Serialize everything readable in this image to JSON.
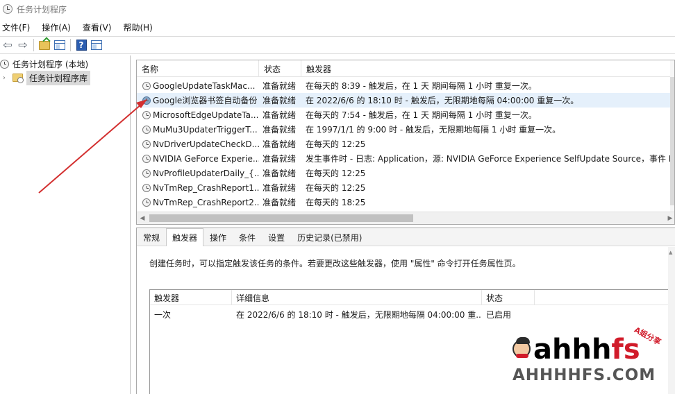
{
  "window": {
    "title": "任务计划程序"
  },
  "menu": [
    "文件(F)",
    "操作(A)",
    "查看(V)",
    "帮助(H)"
  ],
  "tree": {
    "root": "任务计划程序 (本地)",
    "child": "任务计划程序库",
    "expander": "›"
  },
  "task_list": {
    "columns": [
      "名称",
      "状态",
      "触发器"
    ],
    "rows": [
      {
        "name": "GoogleUpdateTaskMac...",
        "status": "准备就绪",
        "trigger": "在每天的 8:39 - 触发后，在 1 天 期间每隔 1 小时 重复一次。"
      },
      {
        "name": "Google浏览器书签自动备份",
        "status": "准备就绪",
        "trigger": "在 2022/6/6 的 18:10 时 - 触发后，无限期地每隔 04:00:00 重复一次。"
      },
      {
        "name": "MicrosoftEdgeUpdateTa...",
        "status": "准备就绪",
        "trigger": "在每天的 7:54 - 触发后，在 1 天 期间每隔 1 小时 重复一次。"
      },
      {
        "name": "MuMu3UpdaterTriggerT...",
        "status": "准备就绪",
        "trigger": "在 1997/1/1 的 9:00 时 - 触发后，无限期地每隔 1 小时 重复一次。"
      },
      {
        "name": "NvDriverUpdateCheckD...",
        "status": "准备就绪",
        "trigger": "在每天的 12:25"
      },
      {
        "name": "NVIDIA GeForce Experie...",
        "status": "准备就绪",
        "trigger": "发生事件时 - 日志: Application，源: NVIDIA GeForce Experience SelfUpdate Source，事件 ID"
      },
      {
        "name": "NvProfileUpdaterDaily_{...",
        "status": "准备就绪",
        "trigger": "在每天的 12:25"
      },
      {
        "name": "NvTmRep_CrashReport1...",
        "status": "准备就绪",
        "trigger": "在每天的 12:25"
      },
      {
        "name": "NvTmRep_CrashReport2...",
        "status": "准备就绪",
        "trigger": "在每天的 18:25"
      }
    ],
    "selected_index": 1
  },
  "detail": {
    "tabs": [
      "常规",
      "触发器",
      "操作",
      "条件",
      "设置",
      "历史记录(已禁用)"
    ],
    "active_tab": 1,
    "description": "创建任务时，可以指定触发该任务的条件。若要更改这些触发器，使用 \"属性\" 命令打开任务属性页。",
    "trigger_table": {
      "columns": [
        "触发器",
        "详细信息",
        "状态"
      ],
      "rows": [
        {
          "trigger": "一次",
          "details": "在 2022/6/6 的 18:10 时 - 触发后，无限期地每隔 04:00:00 重...",
          "status": "已启用"
        }
      ]
    }
  },
  "watermark": {
    "logo_main": "ahhh",
    "logo_accent": "fs",
    "tag": "A姐分享",
    "domain": "AHHHHFS.COM"
  },
  "colors": {
    "selected_row": "#e5f0fb",
    "annotation_arrow": "#d32f2f",
    "watermark_red": "#d11b2a"
  }
}
